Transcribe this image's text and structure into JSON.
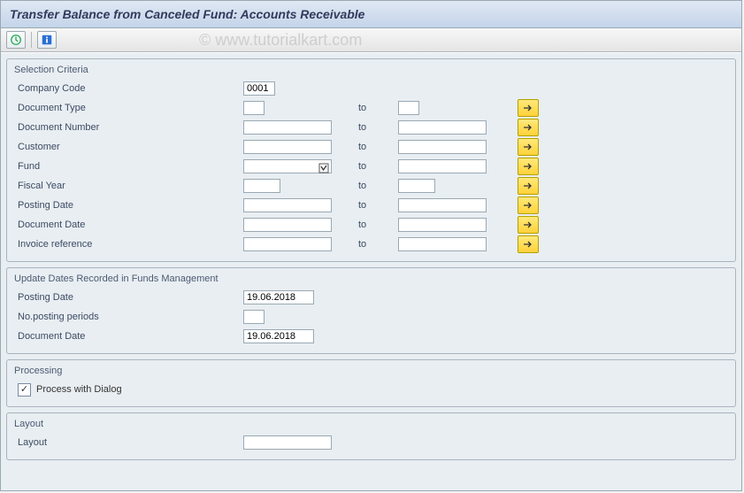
{
  "window": {
    "title": "Transfer Balance from Canceled Fund:  Accounts Receivable"
  },
  "watermark": "© www.tutorialkart.com",
  "groups": {
    "selection": {
      "title": "Selection Criteria",
      "to_label": "to",
      "company_code": {
        "label": "Company Code",
        "value": "0001"
      },
      "doc_type": {
        "label": "Document Type",
        "from": "",
        "to": ""
      },
      "doc_number": {
        "label": "Document Number",
        "from": "",
        "to": ""
      },
      "customer": {
        "label": "Customer",
        "from": "",
        "to": ""
      },
      "fund": {
        "label": "Fund",
        "from": "",
        "to": "",
        "from_has_lookup": true
      },
      "fiscal_year": {
        "label": "Fiscal Year",
        "from": "",
        "to": ""
      },
      "posting_date": {
        "label": "Posting Date",
        "from": "",
        "to": ""
      },
      "document_date": {
        "label": "Document Date",
        "from": "",
        "to": ""
      },
      "invoice_ref": {
        "label": "Invoice reference",
        "from": "",
        "to": ""
      }
    },
    "update_dates": {
      "title": "Update Dates Recorded in Funds Management",
      "posting_date": {
        "label": "Posting Date",
        "value": "19.06.2018"
      },
      "no_periods": {
        "label": "No.posting periods",
        "value": ""
      },
      "document_date": {
        "label": "Document Date",
        "value": "19.06.2018"
      }
    },
    "processing": {
      "title": "Processing",
      "process_dialog": {
        "label": "Process with Dialog",
        "checked": true,
        "checkmark": "✓"
      }
    },
    "layout": {
      "title": "Layout",
      "layout": {
        "label": "Layout",
        "value": ""
      }
    }
  },
  "icons": {
    "execute": "execute-icon",
    "info": "info-icon",
    "multi_select": "right-arrow-icon"
  }
}
